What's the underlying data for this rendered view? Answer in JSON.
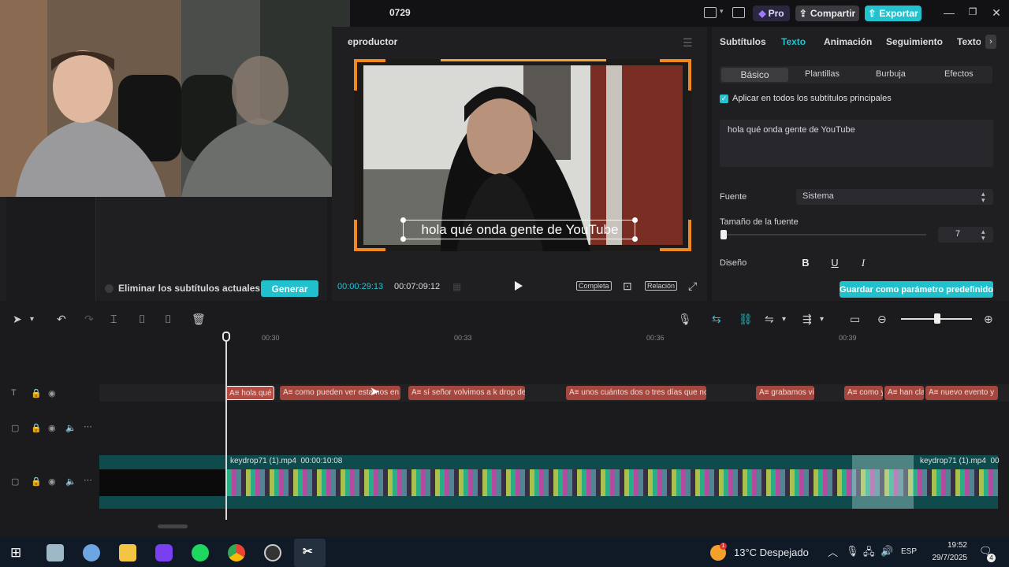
{
  "window": {
    "project_title": "0729",
    "pro_label": "Pro",
    "share_label": "Compartir",
    "export_label": "Exportar"
  },
  "media_panel": {
    "remove_subtitles_label": "Eliminar los subtítulos actuales",
    "generate_label": "Generar"
  },
  "player": {
    "title": "eproductor",
    "subtitle_text": "hola qué onda gente de YouTube",
    "current_time": "00:00:29:13",
    "total_time": "00:07:09:12",
    "full_label": "Completa",
    "ratio_label": "Relación"
  },
  "properties": {
    "tabs": [
      "Subtítulos",
      "Texto",
      "Animación",
      "Seguimiento",
      "Texto"
    ],
    "active_tab_index": 1,
    "subtabs": [
      "Básico",
      "Plantillas",
      "Burbuja",
      "Efectos"
    ],
    "apply_all_label": "Aplicar en todos los subtítulos principales",
    "text_value": "hola qué onda gente de YouTube",
    "font_label": "Fuente",
    "font_value": "Sistema",
    "size_label": "Tamaño de la fuente",
    "size_value": "7",
    "design_label": "Diseño",
    "bold_label": "B",
    "underline_label": "U",
    "italic_label": "I",
    "save_preset_label": "Guardar como parámetro predefinido"
  },
  "timeline": {
    "ruler_labels": [
      "00:30",
      "00:33",
      "00:36",
      "00:39"
    ],
    "subtitle_clips": [
      "A≡ hola qué",
      "A≡ como pueden ver estamos en",
      "A≡ sí señor volvimos a k drop de",
      "A≡ unos cuántos dos o tres días que no",
      "A≡ grabamos vi",
      "A≡ como y",
      "A≡ han cla",
      "A≡ nuevo evento y"
    ],
    "video_clip_name": "keydrop71 (1).mp4",
    "video_clip_duration": "00:00:10:08",
    "video_clip_name_2": "keydrop71 (1).mp4",
    "video_clip_suffix": "00"
  },
  "taskbar": {
    "temperature": "13°C",
    "weather": "Despejado",
    "lang": "ESP",
    "time": "19:52",
    "date": "29/7/2025",
    "notif_count": "4",
    "weather_badge": "1"
  },
  "colors": {
    "accent": "#22c3cf",
    "subtitle_clip": "#a5473f",
    "video_track": "#0f4a4c"
  }
}
